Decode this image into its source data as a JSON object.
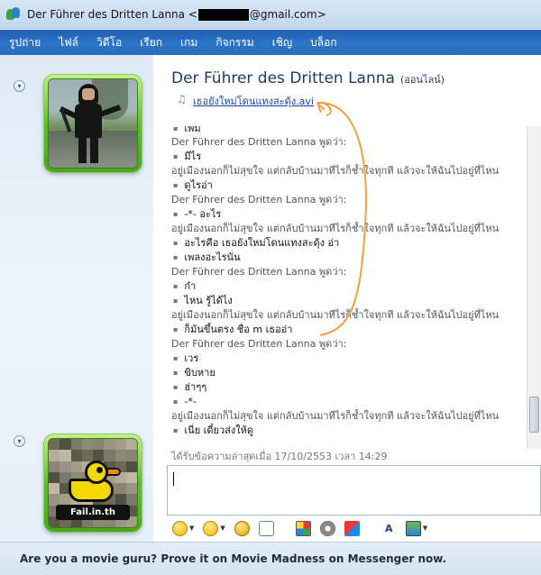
{
  "window": {
    "title_prefix": "Der Führer des Dritten Lanna <",
    "title_suffix": "@gmail.com>"
  },
  "menu": [
    "รูปถ่าย",
    "ไฟล์",
    "วิดีโอ",
    "เรียก",
    "เกม",
    "กิจกรรม",
    "เชิญ",
    "บล็อก"
  ],
  "contact": {
    "name": "Der Führer des Dritten Lanna",
    "status": "(ออนไลน์)",
    "now_playing": "เธอยังใหม่โดนแทงสะดุ้ง.avi"
  },
  "conversation": [
    {
      "type": "msg",
      "text": "เพิ่ม"
    },
    {
      "type": "sender",
      "text": "Der Führer des Dritten Lanna พูดว่า:"
    },
    {
      "type": "msg",
      "text": "มีไร"
    },
    {
      "type": "stat",
      "text": "อยู่เมืองนอกก็ไม่สุขใจ แต่กลับบ้านมาทีไรก็ช้ำใจทุกที แล้วจะให้ฉันไปอยู่ที่ไหน"
    },
    {
      "type": "msg",
      "text": "ดูไรอ่า"
    },
    {
      "type": "sender",
      "text": "Der Führer des Dritten Lanna พูดว่า:"
    },
    {
      "type": "msg",
      "text": "-*- อะไร"
    },
    {
      "type": "stat",
      "text": "อยู่เมืองนอกก็ไม่สุขใจ แต่กลับบ้านมาทีไรก็ช้ำใจทุกที แล้วจะให้ฉันไปอยู่ที่ไหน"
    },
    {
      "type": "msg",
      "text": "อะไรคือ เธอยังใหม่โดนแทงสะดุ้ง อ่า"
    },
    {
      "type": "msg",
      "text": "เพลงอะไรนั่น"
    },
    {
      "type": "sender",
      "text": "Der Führer des Dritten Lanna พูดว่า:"
    },
    {
      "type": "msg",
      "text": "ก๋า"
    },
    {
      "type": "msg",
      "text": "ไหน รู้ได้ไง"
    },
    {
      "type": "stat",
      "text": "อยู่เมืองนอกก็ไม่สุขใจ แต่กลับบ้านมาทีไรก็ช้ำใจทุกที แล้วจะให้ฉันไปอยู่ที่ไหน"
    },
    {
      "type": "msg",
      "text": "ก็มันขึ้นตรง ชื่อ m เธออ่า"
    },
    {
      "type": "sender",
      "text": "Der Führer des Dritten Lanna พูดว่า:"
    },
    {
      "type": "msg",
      "text": "เวร"
    },
    {
      "type": "msg",
      "text": "ขิบหาย"
    },
    {
      "type": "msg",
      "text": "ฮ่าๆๆ"
    },
    {
      "type": "msg",
      "text": "-*-"
    },
    {
      "type": "stat",
      "text": "อยู่เมืองนอกก็ไม่สุขใจ แต่กลับบ้านมาทีไรก็ช้ำใจทุกที แล้วจะให้ฉันไปอยู่ที่ไหน"
    },
    {
      "type": "msg",
      "text": "เนี่ย เดี๋ยวส่งให้ดู"
    }
  ],
  "last_message": "ได้รับข้อความล่าสุดเมื่อ 17/10/2553 เวลา 14:29",
  "own_picture_label": "Fail.in.th",
  "toolbar_icons": [
    "emoticon-icon",
    "wink-icon",
    "voice-clip-icon",
    "nudge-icon",
    "palette-icon",
    "sound-icon",
    "games-icon",
    "font-icon",
    "background-icon"
  ],
  "ad_text": "Are you a movie guru? Prove it on Movie Madness on Messenger now.",
  "colors": {
    "menu_bar": "#2a6cbd",
    "frame_green": "#5cc12b",
    "annotation": "#f5a040"
  }
}
